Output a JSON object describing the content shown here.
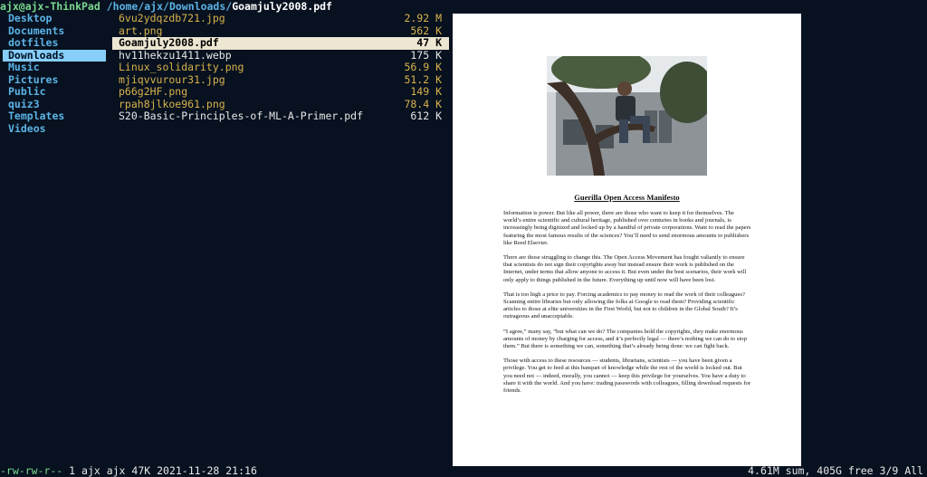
{
  "header": {
    "host": "ajx@ajx-ThinkPad",
    "path": "/home/ajx/Downloads/",
    "file": "Goamjuly2008.pdf"
  },
  "parent_dirs": [
    "Desktop",
    "Documents",
    "dotfiles",
    "Downloads",
    "Music",
    "Pictures",
    "Public",
    "quiz3",
    "Templates",
    "Videos"
  ],
  "files": [
    {
      "name": "6vu2ydqzdb721.jpg",
      "size": "2.92 M",
      "kind": "img"
    },
    {
      "name": "art.png",
      "size": "562 K",
      "kind": "img"
    },
    {
      "name": "Goamjuly2008.pdf",
      "size": "47 K",
      "kind": "sel"
    },
    {
      "name": "hv11hekzu1411.webp",
      "size": "175 K",
      "kind": "doc"
    },
    {
      "name": "Linux_solidarity.png",
      "size": "56.9 K",
      "kind": "img"
    },
    {
      "name": "mjiqvvurour31.jpg",
      "size": "51.2 K",
      "kind": "img"
    },
    {
      "name": "p66g2HF.png",
      "size": "149 K",
      "kind": "img"
    },
    {
      "name": "rpah8jlkoe961.png",
      "size": "78.4 K",
      "kind": "img"
    },
    {
      "name": "S20-Basic-Principles-of-ML-A-Primer.pdf",
      "size": "612 K",
      "kind": "doc"
    }
  ],
  "preview": {
    "title": "Guerilla Open Access Manifesto",
    "paragraphs": [
      "Information is power. But like all power, there are those who want to keep it for themselves. The world’s entire scientific and cultural heritage, published over centuries in books and journals, is increasingly being digitized and locked up by a handful of private corporations. Want to read the papers featuring the most famous results of the sciences? You’ll need to send enormous amounts to publishers like Reed Elsevier.",
      "There are those struggling to change this. The Open Access Movement has fought valiantly to ensure that scientists do not sign their copyrights away but instead ensure their work is published on the Internet, under terms that allow anyone to access it. But even under the best scenarios, their work will only apply to things published in the future. Everything up until now will have been lost.",
      "That is too high a price to pay. Forcing academics to pay money to read the work of their colleagues? Scanning entire libraries but only allowing the folks at Google to read them? Providing scientific articles to those at elite universities in the First World, but not to children in the Global South? It’s outrageous and unacceptable.",
      "“I agree,” many say, “but what can we do? The companies hold the copyrights, they make enormous amounts of money by charging for access, and it’s perfectly legal — there’s nothing we can do to stop them.” But there is something we can, something that’s already being done: we can fight back.",
      "Those with access to these resources — students, librarians, scientists — you have been given a privilege. You get to feed at this banquet of knowledge while the rest of the world is locked out. But you need not — indeed, morally, you cannot — keep this privilege for yourselves. You have a duty to share it with the world. And you have: trading passwords with colleagues, filling download requests for friends."
    ]
  },
  "status": {
    "perms": "-rw-rw-r--",
    "info": " 1 ajx ajx 47K 2021-11-28 21:16",
    "summary": "4.61M sum, 405G free  3/9  All"
  },
  "colors": {
    "background": "#07111f",
    "directory": "#5cb3e6",
    "image_file": "#d9b34c",
    "selection": "#ece6d2",
    "parent_selection": "#87cefa",
    "host": "#7bd88f"
  }
}
